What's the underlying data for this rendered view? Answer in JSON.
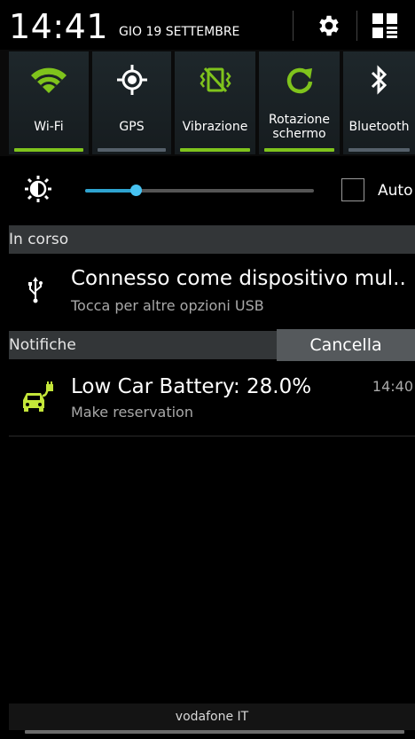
{
  "status": {
    "time": "14:41",
    "date": "GIO 19 SETTEMBRE"
  },
  "toggles": [
    {
      "label": "Wi-Fi",
      "icon": "wifi-icon",
      "active": true
    },
    {
      "label": "GPS",
      "icon": "gps-icon",
      "active": false
    },
    {
      "label": "Vibrazione",
      "icon": "vibration-icon",
      "active": true
    },
    {
      "label": "Rotazione\nschermo",
      "icon": "rotate-icon",
      "active": true
    },
    {
      "label": "Bluetooth",
      "icon": "bluetooth-icon",
      "active": false
    }
  ],
  "brightness": {
    "level": 0.22,
    "auto_label": "Auto",
    "auto_checked": false
  },
  "ongoing": {
    "header": "In corso",
    "items": [
      {
        "title": "Connesso come dispositivo mul..",
        "subtitle": "Tocca per altre opzioni USB",
        "icon": "usb-icon"
      }
    ]
  },
  "notifications": {
    "header": "Notifiche",
    "clear_label": "Cancella",
    "items": [
      {
        "title": "Low Car Battery: 28.0%",
        "subtitle": "Make reservation",
        "time": "14:40",
        "icon": "car-charging-icon"
      }
    ]
  },
  "carrier": "vodafone IT",
  "colors": {
    "active": "#7fc31c",
    "inactive": "#55606a",
    "accent": "#47c3f2",
    "section_bg": "#333638"
  }
}
